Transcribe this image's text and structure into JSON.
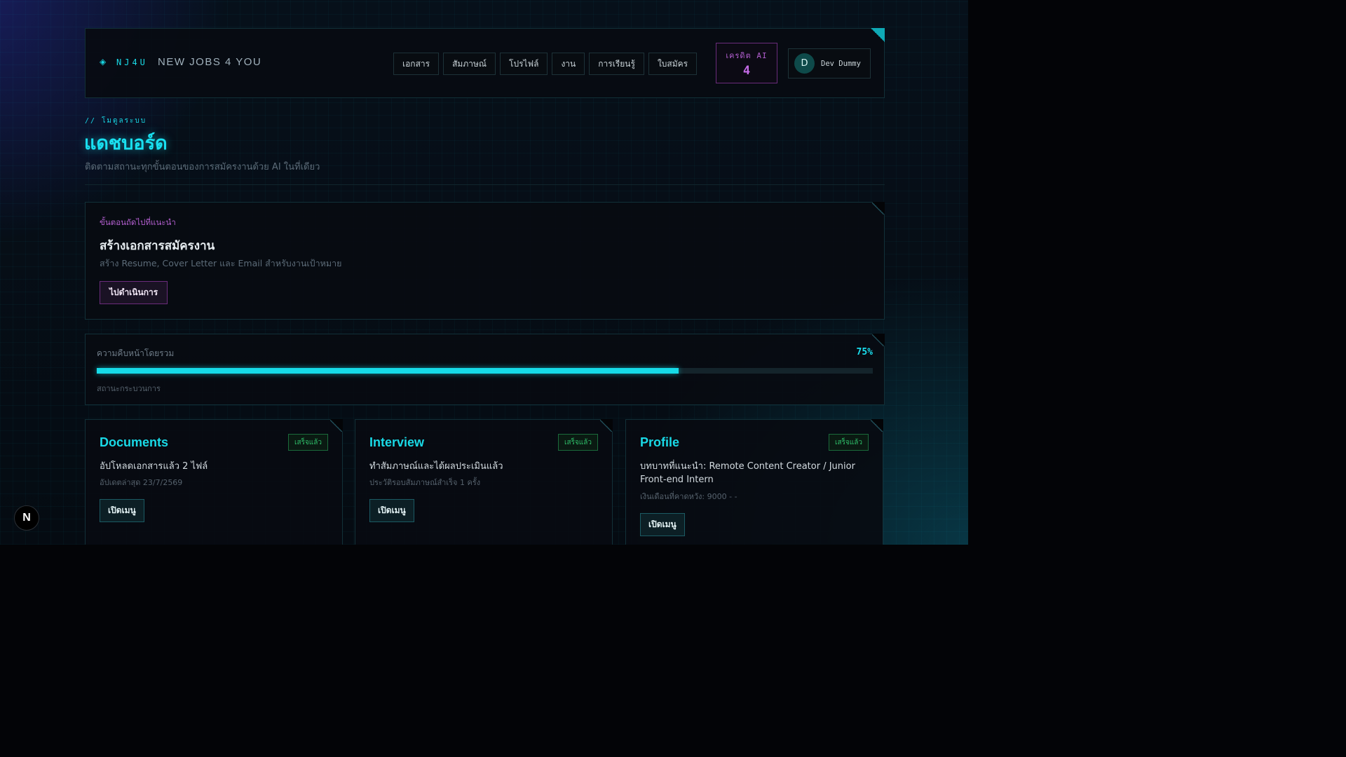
{
  "header": {
    "brand_code": "NJ4U",
    "brand_name": "NEW JOBS 4 YOU",
    "nav": [
      "เอกสาร",
      "สัมภาษณ์",
      "โปรไฟล์",
      "งาน",
      "การเรียนรู้",
      "ใบสมัคร"
    ],
    "credit_label": "เครดิต AI",
    "credit_value": "4",
    "user_initial": "D",
    "user_name": "Dev Dummy"
  },
  "page": {
    "crumb": "// โมดูลระบบ",
    "title": "แดชบอร์ด",
    "subtitle": "ติดตามสถานะทุกขั้นตอนของการสมัครงานด้วย AI ในที่เดียว"
  },
  "next_step": {
    "kicker": "ขั้นตอนถัดไปที่แนะนำ",
    "title": "สร้างเอกสารสมัครงาน",
    "description": "สร้าง Resume, Cover Letter และ Email สำหรับงานเป้าหมาย",
    "button": "ไปดำเนินการ"
  },
  "progress": {
    "label": "ความคืบหน้าโดยรวม",
    "value_text": "75%",
    "value": 0.75,
    "status": "สถานะกระบวนการ"
  },
  "modules": [
    {
      "title": "Documents",
      "badge": "เสร็จแล้ว",
      "text": "อัปโหลดเอกสารแล้ว 2 ไฟล์",
      "sub": "อัปเดตล่าสุด 23/7/2569",
      "button": "เปิดเมนู"
    },
    {
      "title": "Interview",
      "badge": "เสร็จแล้ว",
      "text": "ทำสัมภาษณ์และได้ผลประเมินแล้ว",
      "sub": "ประวัติรอบสัมภาษณ์สำเร็จ 1 ครั้ง",
      "button": "เปิดเมนู"
    },
    {
      "title": "Profile",
      "badge": "เสร็จแล้ว",
      "text": "บทบาทที่แนะนำ: Remote Content Creator / Junior Front-end Intern",
      "sub": "เงินเดือนที่คาดหวัง: 9000 - -",
      "button": "เปิดเมนู"
    }
  ],
  "dev_badge": "N",
  "colors": {
    "accent": "#19e0f0",
    "purple": "#b35fd0",
    "success": "#2fbf6a",
    "background": "#030407"
  }
}
